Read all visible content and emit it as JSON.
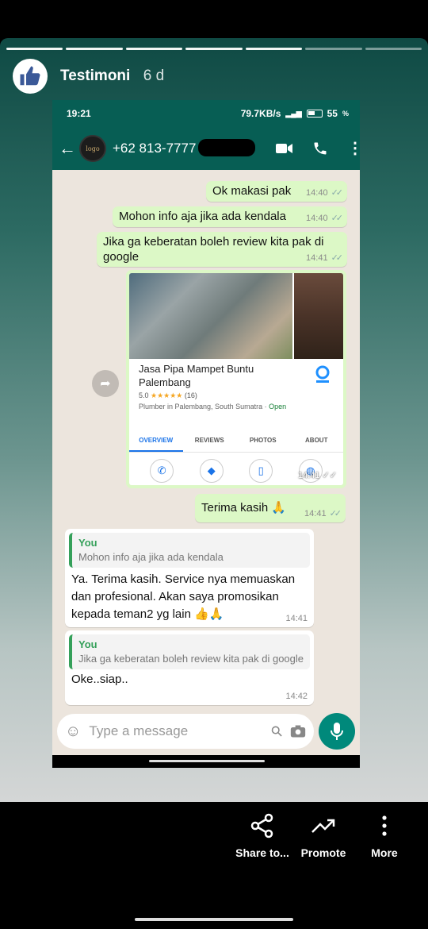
{
  "story": {
    "title": "Testimoni",
    "age": "6 d",
    "progress_segments": 7,
    "progress_active": 5
  },
  "phone": {
    "status": {
      "time": "19:21",
      "speed": "79.7KB/s",
      "network": "4G",
      "battery": "55"
    },
    "chat_name": "+62 813-7777",
    "messages": {
      "m1": {
        "text": "Ok makasi pak",
        "time": "14:40"
      },
      "m2": {
        "text": "Mohon info aja jika ada kendala",
        "time": "14:40"
      },
      "m3": {
        "text": "Jika ga keberatan boleh review kita pak di google",
        "time": "14:41"
      },
      "card": {
        "title": "Jasa Pipa Mampet Buntu Palembang",
        "rating": "5.0",
        "stars": "★★★★★",
        "reviews": "(16)",
        "category": "Plumber in Palembang, South Sumatra",
        "open": "Open",
        "tabs": [
          "OVERVIEW",
          "REVIEWS",
          "PHOTOS",
          "ABOUT"
        ],
        "actions": [
          "CALL",
          "DIRECTIONS",
          "SAVE",
          "WEBSITE"
        ],
        "time": "14:41"
      },
      "m4": {
        "text": "Terima kasih 🙏",
        "time": "14:41"
      },
      "r1": {
        "quote_name": "You",
        "quote_text": "Mohon info aja jika ada kendala",
        "text": "Ya. Terima kasih. Service nya memuaskan dan profesional. Akan saya promosikan kepada teman2 yg lain 👍🙏",
        "time": "14:41"
      },
      "r2": {
        "quote_name": "You",
        "quote_text": "Jika ga keberatan boleh review kita pak di google",
        "text": "Oke..siap..",
        "time": "14:42"
      }
    },
    "input_placeholder": "Type a message"
  },
  "controls": {
    "share": "Share to...",
    "promote": "Promote",
    "more": "More"
  }
}
